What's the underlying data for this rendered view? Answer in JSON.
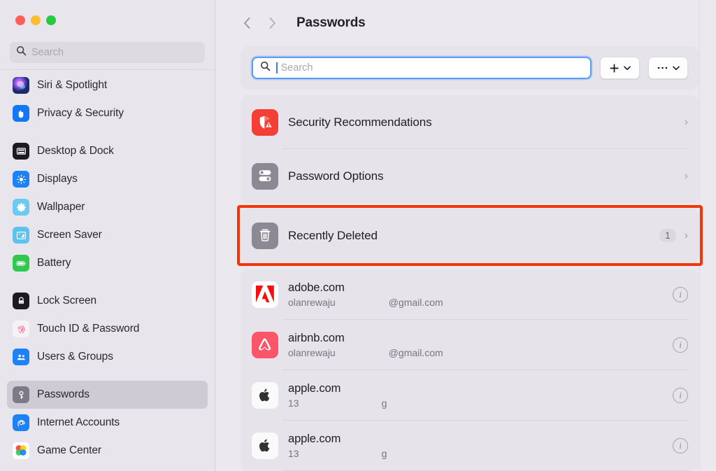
{
  "window": {
    "traffic_lights": [
      {
        "name": "close",
        "color": "#ff5f57"
      },
      {
        "name": "minimize",
        "color": "#febc2e"
      },
      {
        "name": "zoom",
        "color": "#28c840"
      }
    ]
  },
  "sidebar": {
    "search": {
      "placeholder": "Search",
      "value": ""
    },
    "items": [
      {
        "label": "Siri & Spotlight",
        "icon": "siri-icon",
        "selected": false,
        "gap_after": false
      },
      {
        "label": "Privacy & Security",
        "icon": "privacy-hand-icon",
        "selected": false,
        "gap_after": true
      },
      {
        "label": "Desktop & Dock",
        "icon": "desktop-dock-icon",
        "selected": false,
        "gap_after": false
      },
      {
        "label": "Displays",
        "icon": "displays-icon",
        "selected": false,
        "gap_after": false
      },
      {
        "label": "Wallpaper",
        "icon": "wallpaper-icon",
        "selected": false,
        "gap_after": false
      },
      {
        "label": "Screen Saver",
        "icon": "screen-saver-icon",
        "selected": false,
        "gap_after": false
      },
      {
        "label": "Battery",
        "icon": "battery-icon",
        "selected": false,
        "gap_after": true
      },
      {
        "label": "Lock Screen",
        "icon": "lock-screen-icon",
        "selected": false,
        "gap_after": false
      },
      {
        "label": "Touch ID & Password",
        "icon": "touch-id-icon",
        "selected": false,
        "gap_after": false
      },
      {
        "label": "Users & Groups",
        "icon": "users-groups-icon",
        "selected": false,
        "gap_after": true
      },
      {
        "label": "Passwords",
        "icon": "passwords-key-icon",
        "selected": true,
        "gap_after": false
      },
      {
        "label": "Internet Accounts",
        "icon": "internet-at-icon",
        "selected": false,
        "gap_after": false
      },
      {
        "label": "Game Center",
        "icon": "game-center-icon",
        "selected": false,
        "gap_after": false
      }
    ]
  },
  "header": {
    "back_label": "‹",
    "forward_label": "›",
    "title": "Passwords"
  },
  "toolbar": {
    "search": {
      "placeholder": "Search",
      "value": "",
      "focused": true
    },
    "add_button": {
      "label": "+",
      "chevron": "⌄"
    },
    "more_button": {
      "label": "•••",
      "chevron": "⌄"
    }
  },
  "options_card": {
    "rows": [
      {
        "title": "Security Recommendations",
        "icon": "security-shield-icon",
        "count": "",
        "chevron": "›"
      },
      {
        "title": "Password Options",
        "icon": "password-options-icon",
        "count": "",
        "chevron": "›"
      }
    ]
  },
  "recently_deleted": {
    "title": "Recently Deleted",
    "icon": "trash-icon",
    "count": "1",
    "chevron": "›",
    "highlighted": true,
    "highlight_color": "#f3360a"
  },
  "passwords_list": {
    "entries": [
      {
        "title": "adobe.com",
        "icon": "adobe-icon",
        "user": "olanrewaju",
        "domain": "@gmail.com",
        "info_label": "i"
      },
      {
        "title": "airbnb.com",
        "icon": "airbnb-icon",
        "user": "olanrewaju",
        "domain": "@gmail.com",
        "info_label": "i"
      },
      {
        "title": "apple.com",
        "icon": "apple-icon",
        "user": "13",
        "domain": "g",
        "info_label": "i"
      },
      {
        "title": "apple.com",
        "icon": "apple-icon",
        "user": "13",
        "domain": "g",
        "info_label": "i"
      }
    ]
  }
}
